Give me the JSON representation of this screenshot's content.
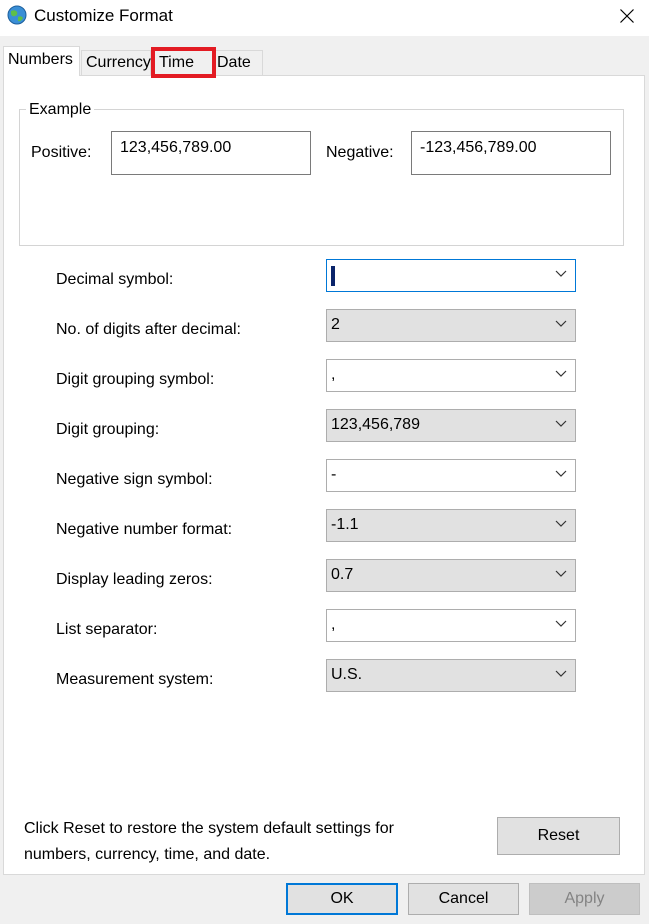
{
  "window": {
    "title": "Customize Format",
    "icon": "globe-icon",
    "close_icon": "close-icon"
  },
  "tabs": [
    {
      "label": "Numbers",
      "active": true
    },
    {
      "label": "Currency",
      "active": false
    },
    {
      "label": "Time",
      "active": false,
      "highlighted": true,
      "highlight_color": "#e31b23"
    },
    {
      "label": "Date",
      "active": false
    }
  ],
  "example": {
    "group_label": "Example",
    "positive_label": "Positive:",
    "positive_value": "123,456,789.00",
    "negative_label": "Negative:",
    "negative_value": "-123,456,789.00"
  },
  "settings": [
    {
      "label": "Decimal symbol:",
      "value": "",
      "editable": true,
      "focused": true
    },
    {
      "label": "No. of digits after decimal:",
      "value": "2",
      "editable": false
    },
    {
      "label": "Digit grouping symbol:",
      "value": ",",
      "editable": true
    },
    {
      "label": "Digit grouping:",
      "value": "123,456,789",
      "editable": false
    },
    {
      "label": "Negative sign symbol:",
      "value": "-",
      "editable": true
    },
    {
      "label": "Negative number format:",
      "value": "-1.1",
      "editable": false
    },
    {
      "label": "Display leading zeros:",
      "value": "0.7",
      "editable": false
    },
    {
      "label": "List separator:",
      "value": ",",
      "editable": true
    },
    {
      "label": "Measurement system:",
      "value": "U.S.",
      "editable": false
    }
  ],
  "footer": {
    "note": "Click Reset to restore the system default settings for numbers, currency, time, and date.",
    "reset_label": "Reset"
  },
  "buttons": {
    "ok": "OK",
    "cancel": "Cancel",
    "apply": "Apply"
  },
  "colors": {
    "focus_accent": "#0078d7",
    "highlight": "#e31b23"
  }
}
